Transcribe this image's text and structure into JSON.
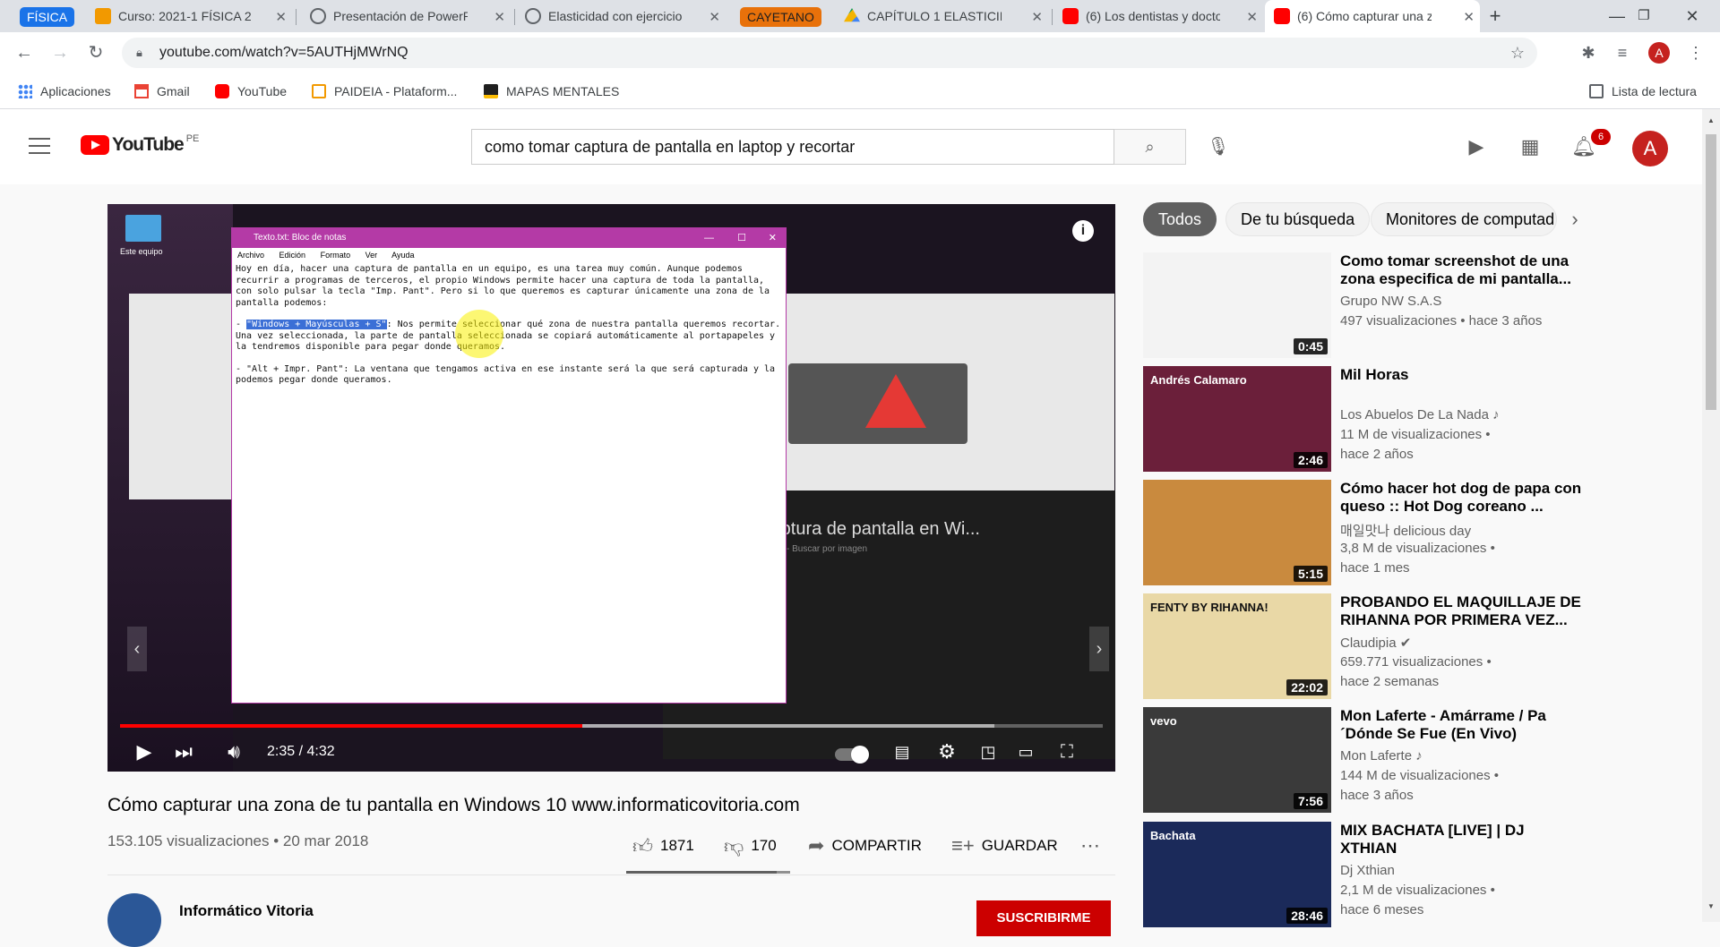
{
  "browser": {
    "tab_groups": [
      {
        "label": "FÍSICA",
        "color": "#1a73e8"
      },
      {
        "label": "CAYETANO",
        "color": "#e8710a"
      }
    ],
    "tabs": [
      {
        "title": "Curso: 2021-1 FÍSICA 2 (",
        "icon": "moodle-icon"
      },
      {
        "title": "Presentación de PowerP",
        "icon": "globe-icon"
      },
      {
        "title": "Elasticidad con ejercicio",
        "icon": "globe-icon"
      },
      {
        "title": "CAPÍTULO 1 ELASTICIDA",
        "icon": "google-drive-icon"
      },
      {
        "title": "(6) Los dentistas y docto",
        "icon": "youtube-icon"
      },
      {
        "title": "(6) Cómo capturar una z",
        "icon": "youtube-icon"
      }
    ],
    "url": "youtube.com/watch?v=5AUTHjMWrNQ",
    "profile_initial": "A",
    "bookmarks": [
      {
        "label": "Aplicaciones",
        "icon": "apps-grid-icon"
      },
      {
        "label": "Gmail",
        "icon": "gmail-icon"
      },
      {
        "label": "YouTube",
        "icon": "youtube-icon"
      },
      {
        "label": "PAIDEIA - Plataform...",
        "icon": "paideia-icon"
      },
      {
        "label": "MAPAS MENTALES",
        "icon": "mapas-icon"
      }
    ],
    "reading_list": "Lista de lectura"
  },
  "youtube": {
    "logo_text": "YouTube",
    "country_code": "PE",
    "search_query": "como tomar captura de pantalla en laptop y recortar",
    "notification_count": "6",
    "avatar_initial": "A"
  },
  "player": {
    "current_time": "2:35 / 4:32",
    "played_fraction": 0.47,
    "notepad": {
      "title": "Texto.txt: Bloc de notas",
      "menu": [
        "Archivo",
        "Edición",
        "Formato",
        "Ver",
        "Ayuda"
      ],
      "para1": "Hoy en día, hacer una captura de pantalla en un equipo, es una tarea muy común. Aunque podemos recurrir a programas de terceros, el propio Windows permite hacer una captura de toda la pantalla, con solo pulsar la tecla \"Imp. Pant\". Pero si lo que queremos es capturar únicamente una zona de la pantalla podemos:",
      "para2_highlight": "\"Windows + Mayúsculas + S\"",
      "para2_rest": ": Nos permite seleccionar qué zona de nuestra pantalla queremos recortar. Una vez seleccionada, la parte de pantalla seleccionada se copiará automáticamente al portapapeles y la tendremos disponible para pegar donde queramos.",
      "para3": "- \"Alt + Impr. Pant\": La ventana que tengamos activa en ese instante será la que será capturada y la podemos pegar donde queramos."
    },
    "desktop_label": "Este equipo",
    "bg_heading": "hacer una captura de pantalla en Wi...",
    "bg_sub": "Mejor Antivirus - 538 × 359 - Buscar por imagen"
  },
  "video": {
    "title": "Cómo capturar una zona de tu pantalla en Windows 10 www.informaticovitoria.com",
    "meta": "153.105 visualizaciones • 20 mar 2018",
    "likes": "1871",
    "dislikes": "170",
    "share_label": "COMPARTIR",
    "save_label": "GUARDAR",
    "like_fraction": 0.917,
    "channel_name": "Informático Vitoria",
    "subscribe_label": "SUSCRIBIRME"
  },
  "chips": [
    "Todos",
    "De tu búsqueda",
    "Monitores de computad"
  ],
  "recommendations": [
    {
      "title": "Como tomar screenshot de una zona especifica de mi pantalla...",
      "channel": "Grupo NW S.A.S",
      "views": "497 visualizaciones • hace 3 años",
      "age": "",
      "duration": "0:45",
      "thumb_color": "#f3f3f3",
      "thumb_label": ""
    },
    {
      "title": "Mil Horas",
      "channel": "Los Abuelos De La Nada ♪",
      "views": "11 M de visualizaciones •",
      "age": "hace 2 años",
      "duration": "2:46",
      "thumb_color": "#6b1f3a",
      "thumb_label": "Andrés Calamaro"
    },
    {
      "title": "Cómo hacer hot dog de papa con queso :: Hot Dog coreano ...",
      "channel": "매일맛나 delicious day",
      "views": "3,8 M de visualizaciones •",
      "age": "hace 1 mes",
      "duration": "5:15",
      "thumb_color": "#c98a3e",
      "thumb_label": ""
    },
    {
      "title": "PROBANDO EL MAQUILLAJE DE RIHANNA POR PRIMERA VEZ...",
      "channel": "Claudipia ✔",
      "views": "659.771 visualizaciones •",
      "age": "hace 2 semanas",
      "duration": "22:02",
      "thumb_color": "#e9d8a6",
      "thumb_label": "FENTY BY RIHANNA!"
    },
    {
      "title": "Mon Laferte - Amárrame / Pa ´Dónde Se Fue (En Vivo)",
      "channel": "Mon Laferte ♪",
      "views": "144 M de visualizaciones •",
      "age": "hace 3 años",
      "duration": "7:56",
      "thumb_color": "#3a3a3a",
      "thumb_label": "vevo"
    },
    {
      "title": "MIX BACHATA [LIVE] | DJ XTHIAN",
      "channel": "Dj Xthian",
      "views": "2,1 M de visualizaciones •",
      "age": "hace 6 meses",
      "duration": "28:46",
      "thumb_color": "#1b2a5a",
      "thumb_label": "Bachata"
    }
  ]
}
